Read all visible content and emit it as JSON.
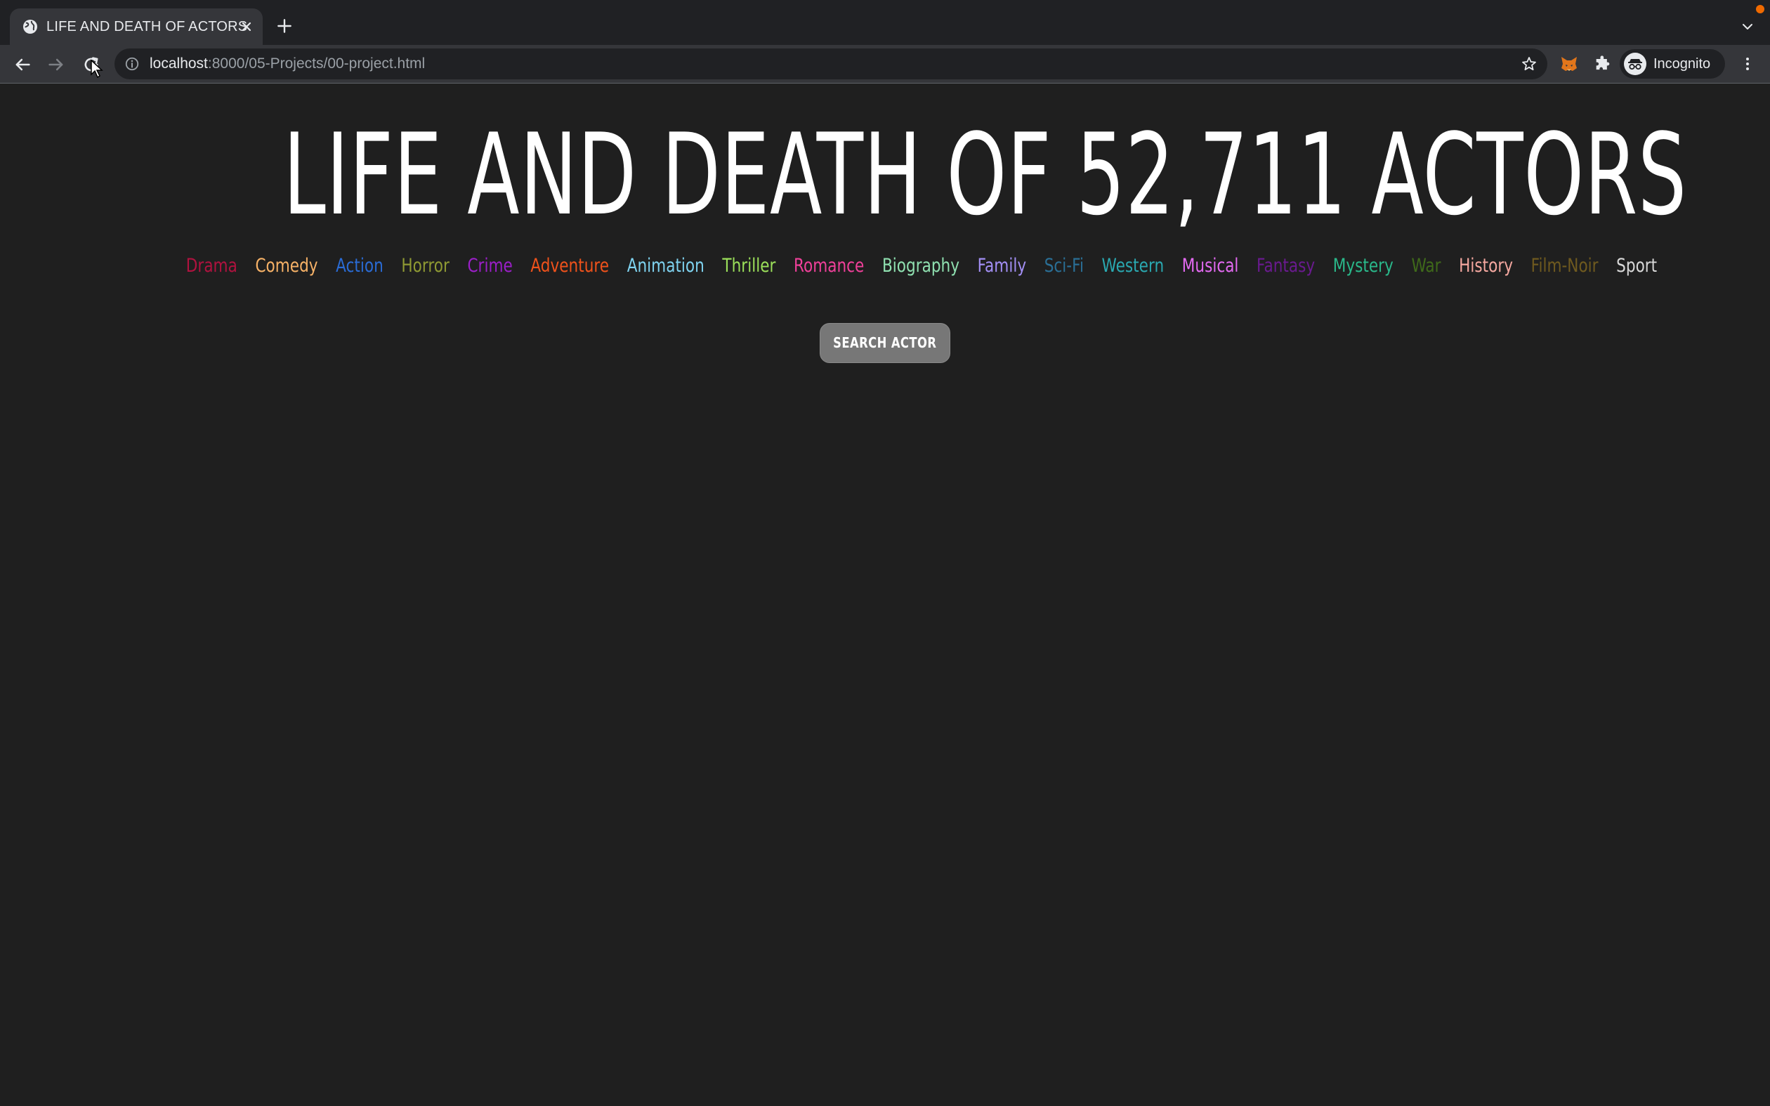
{
  "browser": {
    "tab": {
      "title": "LIFE AND DEATH OF ACTORS"
    },
    "omnibox": {
      "host": "localhost",
      "path": ":8000/05-Projects/00-project.html"
    },
    "profile": {
      "label": "Incognito"
    }
  },
  "page": {
    "title": "LIFE AND DEATH OF 52,711 ACTORS",
    "genres": [
      {
        "label": "Drama",
        "color": "#b0123f"
      },
      {
        "label": "Comedy",
        "color": "#f7b267"
      },
      {
        "label": "Action",
        "color": "#2a6bd4"
      },
      {
        "label": "Horror",
        "color": "#8f9a33"
      },
      {
        "label": "Crime",
        "color": "#9b1fc8"
      },
      {
        "label": "Adventure",
        "color": "#f0521b"
      },
      {
        "label": "Animation",
        "color": "#7fd3f0"
      },
      {
        "label": "Thriller",
        "color": "#9be05a"
      },
      {
        "label": "Romance",
        "color": "#f0409a"
      },
      {
        "label": "Biography",
        "color": "#8fe0b0"
      },
      {
        "label": "Family",
        "color": "#a38ff5"
      },
      {
        "label": "Sci-Fi",
        "color": "#2a6f96"
      },
      {
        "label": "Western",
        "color": "#2aa8b0"
      },
      {
        "label": "Musical",
        "color": "#e46af2"
      },
      {
        "label": "Fantasy",
        "color": "#6a1a8f"
      },
      {
        "label": "Mystery",
        "color": "#2ab88a"
      },
      {
        "label": "War",
        "color": "#3f6a1a"
      },
      {
        "label": "History",
        "color": "#f5a8a0"
      },
      {
        "label": "Film-Noir",
        "color": "#6f5a1f"
      },
      {
        "label": "Sport",
        "color": "#d8d8d8"
      }
    ],
    "search_button": {
      "label": "SEARCH ACTOR"
    }
  }
}
